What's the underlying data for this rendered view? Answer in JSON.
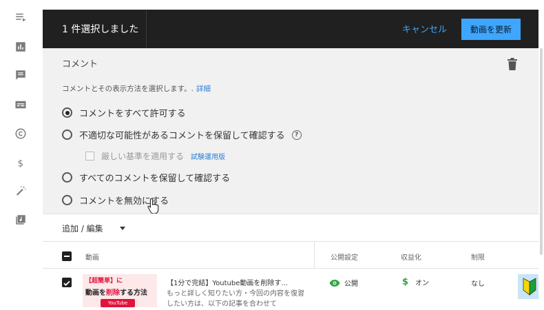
{
  "selection_bar": {
    "count_text": "1 件選択しました",
    "cancel_label": "キャンセル",
    "update_label": "動画を更新"
  },
  "comments": {
    "title": "コメント",
    "description": "コメントとその表示方法を選択します。.",
    "detail_link": "詳細",
    "options": [
      {
        "label": "コメントをすべて許可する",
        "selected": true
      },
      {
        "label": "不適切な可能性があるコメントを保留して確認する",
        "selected": false
      },
      {
        "label": "すべてのコメントを保留して確認する",
        "selected": false
      },
      {
        "label": "コメントを無効にする",
        "selected": false
      }
    ],
    "strict_label": "厳しい基準を適用する",
    "strict_beta": "試験運用版",
    "help_glyph": "?"
  },
  "add_edit": {
    "label": "追加 / 編集"
  },
  "table": {
    "columns": {
      "video": "動画",
      "visibility": "公開設定",
      "monetization": "収益化",
      "restrictions": "制限"
    },
    "rows": [
      {
        "selected": true,
        "thumb_line1": "【超簡単】に",
        "thumb_line2_a": "動画",
        "thumb_line2_b": "を",
        "thumb_line2_c": "削除",
        "thumb_line2_d": "する方法",
        "thumb_badge": "YouTube",
        "title": "【1分で完結】Youtube動画を削除す...",
        "description": "もっと詳しく知りたい方・今回の内容を復習したい方は、以下の記事を合わせて",
        "visibility": "公開",
        "monetization": "オン",
        "restrictions": "なし"
      }
    ]
  },
  "icons": {
    "rail": [
      "playlist-icon",
      "analytics-icon",
      "comments-icon",
      "subtitles-icon",
      "copyright-icon",
      "monetization-icon",
      "customization-icon",
      "audio-library-icon"
    ]
  },
  "colors": {
    "accent": "#3ea6ff",
    "bar_bg": "#202020",
    "panel_bg": "#f1f1f1",
    "monetization_green": "#2ba640"
  }
}
